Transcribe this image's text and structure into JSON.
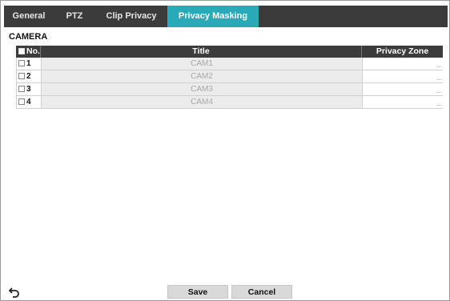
{
  "tabs": [
    {
      "label": "General",
      "active": false
    },
    {
      "label": "PTZ",
      "active": false
    },
    {
      "label": "Clip Privacy",
      "active": false
    },
    {
      "label": "Privacy Masking",
      "active": true
    }
  ],
  "section_title": "CAMERA",
  "table": {
    "columns": [
      "No.",
      "Title",
      "Privacy Zone"
    ],
    "rows": [
      {
        "no": "1",
        "title": "CAM1",
        "zone": "...",
        "checked": false
      },
      {
        "no": "2",
        "title": "CAM2",
        "zone": "...",
        "checked": false
      },
      {
        "no": "3",
        "title": "CAM3",
        "zone": "...",
        "checked": false
      },
      {
        "no": "4",
        "title": "CAM4",
        "zone": "...",
        "checked": false
      }
    ]
  },
  "footer": {
    "back_icon": "return-arrow-icon",
    "save_label": "Save",
    "cancel_label": "Cancel"
  },
  "colors": {
    "tab_bar": "#3b3b3b",
    "tab_active": "#2aaab8",
    "header": "#3c3c3c",
    "button": "#d9d9d9"
  }
}
